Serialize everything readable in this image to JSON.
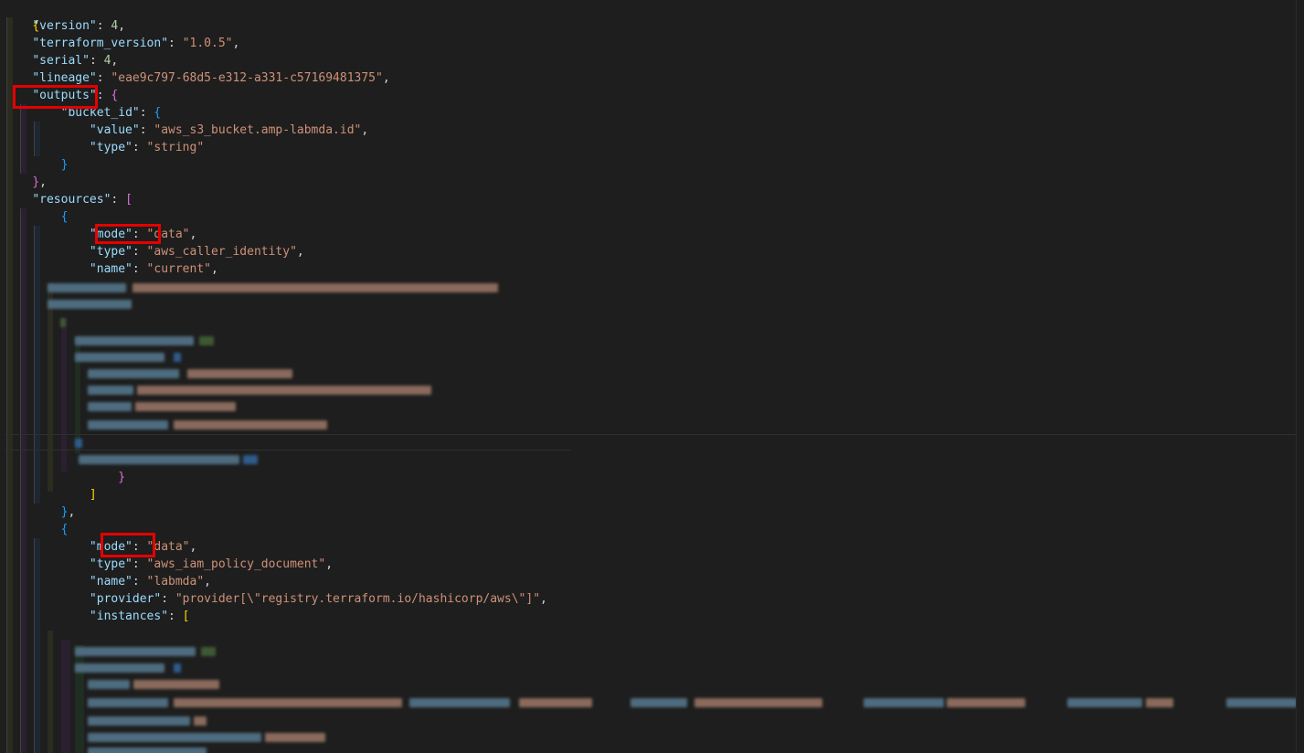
{
  "editor": {
    "lines": {
      "l1": "{",
      "l2_key": "\"version\"",
      "l2_val": "4",
      "l3_key": "\"terraform_version\"",
      "l3_val": "\"1.0.5\"",
      "l4_key": "\"serial\"",
      "l4_val": "4",
      "l5_key": "\"lineage\"",
      "l5_val": "\"eae9c797-68d5-e312-a331-c57169481375\"",
      "l6_key": "\"outputs\"",
      "l7_key": "\"bucket_id\"",
      "l8_key": "\"value\"",
      "l8_val": "\"aws_s3_bucket.amp-labmda.id\"",
      "l9_key": "\"type\"",
      "l9_val": "\"string\"",
      "l12_key": "\"resources\"",
      "l14_key": "\"mode\"",
      "l14_val": "\"data\"",
      "l15_key": "\"type\"",
      "l15_val": "\"aws_caller_identity\"",
      "l16_key": "\"name\"",
      "l16_val": "\"current\"",
      "l32_key": "\"mode\"",
      "l32_val": "\"data\"",
      "l33_key": "\"type\"",
      "l33_val": "\"aws_iam_policy_document\"",
      "l34_key": "\"name\"",
      "l34_val": "\"labmda\"",
      "l35_key": "\"provider\"",
      "l35_val": "\"provider[\\\"registry.terraform.io/hashicorp/aws\\\"]\"",
      "l36_key": "\"instances\""
    }
  }
}
